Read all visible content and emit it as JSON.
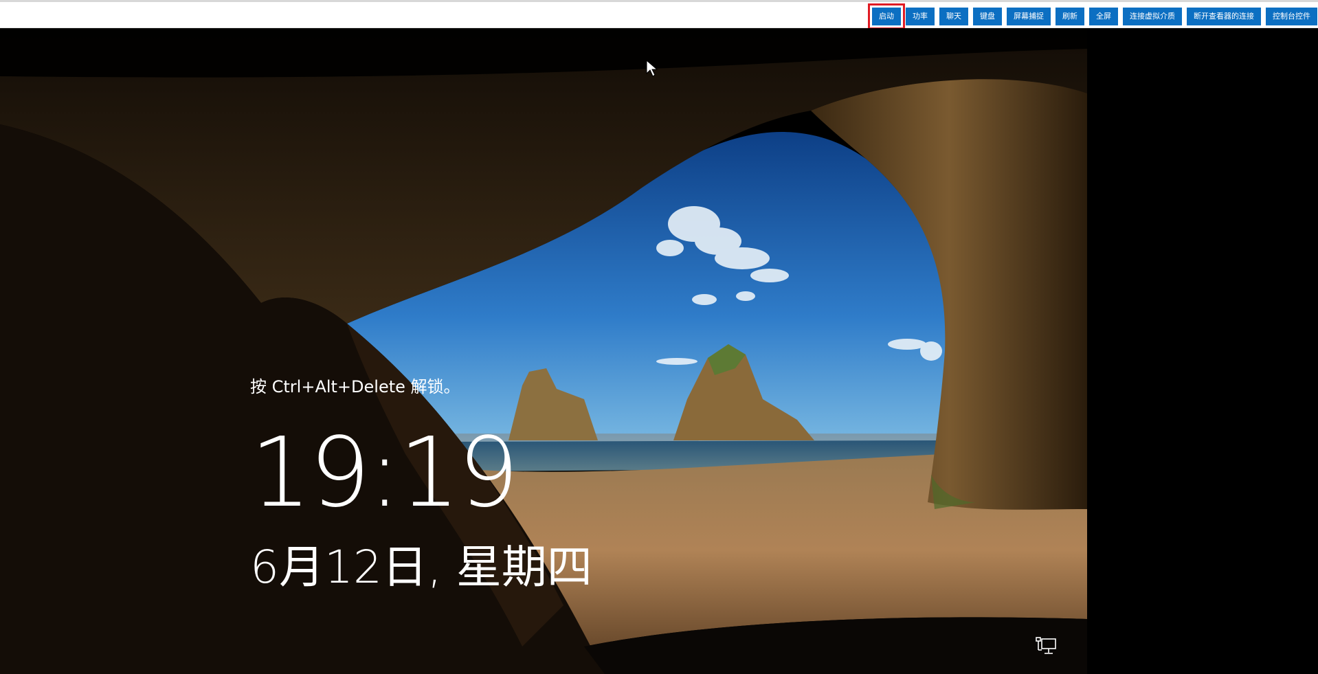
{
  "toolbar": {
    "buttons": [
      {
        "label": "启动",
        "highlighted": true
      },
      {
        "label": "功率"
      },
      {
        "label": "聊天"
      },
      {
        "label": "键盘"
      },
      {
        "label": "屏幕捕捉"
      },
      {
        "label": "刷新"
      },
      {
        "label": "全屏"
      },
      {
        "label": "连接虚拟介质"
      },
      {
        "label": "断开查看器的连接"
      },
      {
        "label": "控制台控件"
      }
    ],
    "button_color": "#0c6fc2",
    "highlight_color": "#e01b24"
  },
  "lockscreen": {
    "unlock_hint": "按 Ctrl+Alt+Delete 解锁。",
    "time": "19:19",
    "date": "6月12日, 星期四",
    "network_icon": "network-icon"
  }
}
